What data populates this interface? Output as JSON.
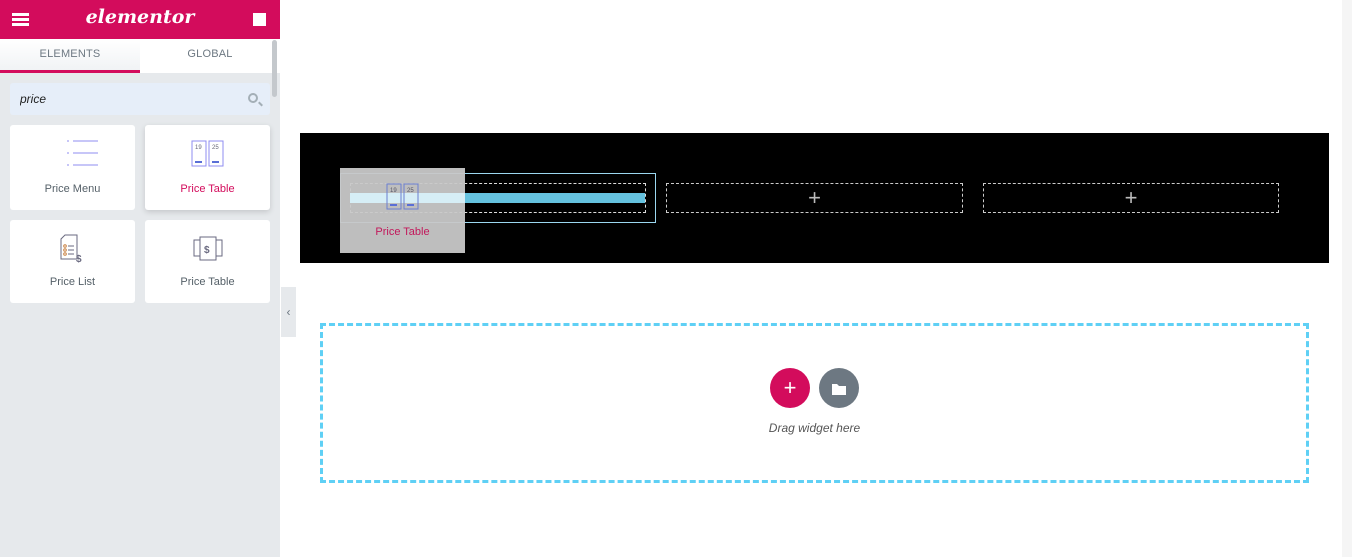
{
  "header": {
    "logo": "elementor",
    "menu_icon": "hamburger-icon",
    "apps_icon": "grid-icon"
  },
  "tabs": [
    {
      "label": "ELEMENTS",
      "active": true
    },
    {
      "label": "GLOBAL",
      "active": false
    }
  ],
  "search": {
    "value": "price",
    "icon": "search-icon"
  },
  "widgets": [
    {
      "label": "Price Menu",
      "icon": "price-menu-icon"
    },
    {
      "label": "Price Table",
      "icon": "price-table-icon",
      "highlighted": true
    },
    {
      "label": "Price List",
      "icon": "price-list-icon"
    },
    {
      "label": "Price Table",
      "icon": "price-table-dollar-icon"
    }
  ],
  "canvas": {
    "dragging_widget": "Price Table",
    "add_icon": "+",
    "drop_zone_text": "Drag widget here"
  },
  "colors": {
    "brand": "#d30c5c",
    "drop_indicator": "#65c2df",
    "drop_zone_border": "#5fd0f5"
  }
}
